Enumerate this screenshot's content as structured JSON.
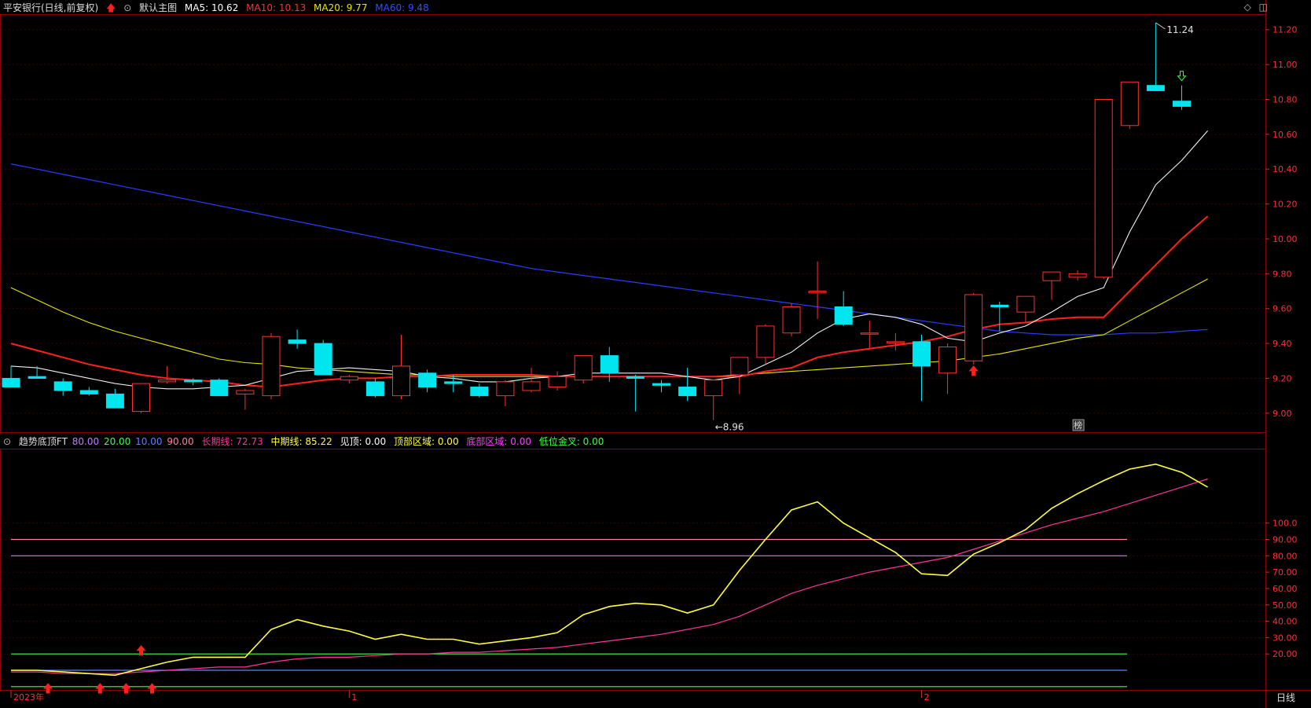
{
  "main": {
    "title": "平安银行(日线,前复权)",
    "template_label": "默认主图",
    "legend": [
      {
        "label": "MA5: 10.62",
        "color": "#ffffff"
      },
      {
        "label": "MA10: 10.13",
        "color": "#ff3030"
      },
      {
        "label": "MA20: 9.77",
        "color": "#e6e600"
      },
      {
        "label": "MA60: 9.48",
        "color": "#3050ff"
      }
    ],
    "y_ticks": [
      "11.20",
      "11.00",
      "10.80",
      "10.60",
      "10.40",
      "10.20",
      "10.00",
      "9.80",
      "9.60",
      "9.40",
      "9.20",
      "9.00"
    ],
    "high_label": "11.24",
    "low_label": "8.96",
    "tag_label": "榜"
  },
  "indicator": {
    "name": "趋势底顶FT",
    "legend": [
      {
        "label": "80.00",
        "color": "#c080ff"
      },
      {
        "label": "20.00",
        "color": "#40ff40"
      },
      {
        "label": "10.00",
        "color": "#6080ff"
      },
      {
        "label": "90.00",
        "color": "#ff80a0"
      },
      {
        "label": "长期线: 72.73",
        "color": "#ff3399"
      },
      {
        "label": "中期线: 85.22",
        "color": "#ffff40"
      },
      {
        "label": "见顶: 0.00",
        "color": "#ffffff"
      },
      {
        "label": "顶部区域: 0.00",
        "color": "#ffff40"
      },
      {
        "label": "底部区域: 0.00",
        "color": "#ff40ff"
      },
      {
        "label": "低位金叉: 0.00",
        "color": "#40ff40"
      }
    ],
    "y_ticks": [
      "100.0",
      "90.00",
      "80.00",
      "70.00",
      "60.00",
      "50.00",
      "40.00",
      "30.00",
      "20.00"
    ]
  },
  "x_labels": [
    "2023年",
    "1",
    "2"
  ],
  "period_label": "日线",
  "colors": {
    "up": "#ff3030",
    "down": "#00e5ee",
    "grid": "#3a0000",
    "axis": "#8b0000"
  },
  "chart_data": {
    "type": "candlestick",
    "candles": [
      {
        "o": 9.2,
        "h": 9.27,
        "l": 9.15,
        "c": 9.15
      },
      {
        "o": 9.21,
        "h": 9.27,
        "l": 9.2,
        "c": 9.2
      },
      {
        "o": 9.18,
        "h": 9.2,
        "l": 9.1,
        "c": 9.13
      },
      {
        "o": 9.13,
        "h": 9.15,
        "l": 9.1,
        "c": 9.11
      },
      {
        "o": 9.11,
        "h": 9.14,
        "l": 9.03,
        "c": 9.03
      },
      {
        "o": 9.01,
        "h": 9.17,
        "l": 9.0,
        "c": 9.17
      },
      {
        "o": 9.18,
        "h": 9.27,
        "l": 9.17,
        "c": 9.19
      },
      {
        "o": 9.19,
        "h": 9.2,
        "l": 9.16,
        "c": 9.18
      },
      {
        "o": 9.19,
        "h": 9.2,
        "l": 9.1,
        "c": 9.1
      },
      {
        "o": 9.11,
        "h": 9.14,
        "l": 9.02,
        "c": 9.13
      },
      {
        "o": 9.1,
        "h": 9.46,
        "l": 9.08,
        "c": 9.44
      },
      {
        "o": 9.42,
        "h": 9.48,
        "l": 9.37,
        "c": 9.4
      },
      {
        "o": 9.4,
        "h": 9.42,
        "l": 9.22,
        "c": 9.22
      },
      {
        "o": 9.19,
        "h": 9.22,
        "l": 9.17,
        "c": 9.21
      },
      {
        "o": 9.18,
        "h": 9.2,
        "l": 9.09,
        "c": 9.1
      },
      {
        "o": 9.1,
        "h": 9.45,
        "l": 9.08,
        "c": 9.27
      },
      {
        "o": 9.23,
        "h": 9.25,
        "l": 9.12,
        "c": 9.15
      },
      {
        "o": 9.18,
        "h": 9.22,
        "l": 9.12,
        "c": 9.17
      },
      {
        "o": 9.15,
        "h": 9.17,
        "l": 9.09,
        "c": 9.1
      },
      {
        "o": 9.1,
        "h": 9.19,
        "l": 9.04,
        "c": 9.18
      },
      {
        "o": 9.13,
        "h": 9.26,
        "l": 9.12,
        "c": 9.18
      },
      {
        "o": 9.15,
        "h": 9.24,
        "l": 9.13,
        "c": 9.21
      },
      {
        "o": 9.19,
        "h": 9.33,
        "l": 9.17,
        "c": 9.33
      },
      {
        "o": 9.33,
        "h": 9.38,
        "l": 9.18,
        "c": 9.23
      },
      {
        "o": 9.21,
        "h": 9.22,
        "l": 9.01,
        "c": 9.2
      },
      {
        "o": 9.17,
        "h": 9.19,
        "l": 9.12,
        "c": 9.16
      },
      {
        "o": 9.15,
        "h": 9.26,
        "l": 9.07,
        "c": 9.1
      },
      {
        "o": 9.1,
        "h": 9.18,
        "l": 8.96,
        "c": 9.19
      },
      {
        "o": 9.22,
        "h": 9.32,
        "l": 9.11,
        "c": 9.32
      },
      {
        "o": 9.32,
        "h": 9.51,
        "l": 9.28,
        "c": 9.5
      },
      {
        "o": 9.46,
        "h": 9.63,
        "l": 9.44,
        "c": 9.61
      },
      {
        "o": 9.69,
        "h": 9.87,
        "l": 9.54,
        "c": 9.7
      },
      {
        "o": 9.61,
        "h": 9.7,
        "l": 9.5,
        "c": 9.51
      },
      {
        "o": 9.46,
        "h": 9.53,
        "l": 9.37,
        "c": 9.46
      },
      {
        "o": 9.41,
        "h": 9.46,
        "l": 9.36,
        "c": 9.41
      },
      {
        "o": 9.41,
        "h": 9.45,
        "l": 9.07,
        "c": 9.27
      },
      {
        "o": 9.23,
        "h": 9.4,
        "l": 9.11,
        "c": 9.38
      },
      {
        "o": 9.3,
        "h": 9.69,
        "l": 9.28,
        "c": 9.68
      },
      {
        "o": 9.62,
        "h": 9.64,
        "l": 9.47,
        "c": 9.61
      },
      {
        "o": 9.58,
        "h": 9.67,
        "l": 9.52,
        "c": 9.67
      },
      {
        "o": 9.76,
        "h": 9.81,
        "l": 9.65,
        "c": 9.81
      },
      {
        "o": 9.78,
        "h": 9.82,
        "l": 9.76,
        "c": 9.8
      },
      {
        "o": 9.78,
        "h": 10.8,
        "l": 9.77,
        "c": 10.8
      },
      {
        "o": 10.65,
        "h": 10.9,
        "l": 10.63,
        "c": 10.9
      },
      {
        "o": 10.88,
        "h": 11.24,
        "l": 10.85,
        "c": 10.85
      },
      {
        "o": 10.79,
        "h": 10.88,
        "l": 10.74,
        "c": 10.76
      }
    ],
    "ma5": [
      9.27,
      9.26,
      9.23,
      9.2,
      9.17,
      9.15,
      9.14,
      9.14,
      9.15,
      9.16,
      9.2,
      9.24,
      9.25,
      9.26,
      9.25,
      9.24,
      9.21,
      9.2,
      9.18,
      9.18,
      9.2,
      9.21,
      9.23,
      9.23,
      9.23,
      9.23,
      9.21,
      9.19,
      9.21,
      9.28,
      9.35,
      9.46,
      9.54,
      9.57,
      9.55,
      9.51,
      9.43,
      9.41,
      9.46,
      9.5,
      9.58,
      9.67,
      9.72,
      10.04,
      10.31,
      10.45,
      10.62
    ],
    "ma10": [
      9.4,
      9.36,
      9.32,
      9.28,
      9.25,
      9.22,
      9.2,
      9.19,
      9.18,
      9.16,
      9.15,
      9.17,
      9.19,
      9.2,
      9.2,
      9.21,
      9.21,
      9.22,
      9.22,
      9.22,
      9.22,
      9.21,
      9.21,
      9.21,
      9.21,
      9.21,
      9.21,
      9.21,
      9.21,
      9.24,
      9.26,
      9.32,
      9.35,
      9.37,
      9.39,
      9.41,
      9.44,
      9.48,
      9.51,
      9.52,
      9.54,
      9.55,
      9.55,
      9.7,
      9.85,
      10.0,
      10.13
    ],
    "ma20": [
      9.72,
      9.65,
      9.58,
      9.52,
      9.47,
      9.43,
      9.39,
      9.35,
      9.31,
      9.29,
      9.28,
      9.26,
      9.25,
      9.24,
      9.23,
      9.22,
      9.22,
      9.21,
      9.21,
      9.21,
      9.21,
      9.21,
      9.21,
      9.21,
      9.21,
      9.21,
      9.21,
      9.21,
      9.22,
      9.23,
      9.24,
      9.25,
      9.26,
      9.27,
      9.28,
      9.29,
      9.3,
      9.32,
      9.34,
      9.37,
      9.4,
      9.43,
      9.45,
      9.53,
      9.61,
      9.69,
      9.77
    ],
    "ma60": [
      10.43,
      10.4,
      10.37,
      10.34,
      10.31,
      10.28,
      10.25,
      10.22,
      10.19,
      10.16,
      10.13,
      10.1,
      10.07,
      10.04,
      10.01,
      9.98,
      9.95,
      9.92,
      9.89,
      9.86,
      9.83,
      9.81,
      9.79,
      9.77,
      9.75,
      9.73,
      9.71,
      9.69,
      9.67,
      9.65,
      9.63,
      9.61,
      9.59,
      9.57,
      9.55,
      9.53,
      9.51,
      9.49,
      9.47,
      9.46,
      9.45,
      9.45,
      9.45,
      9.46,
      9.46,
      9.47,
      9.48
    ],
    "ind_mid": [
      10,
      10,
      9,
      8,
      7,
      11,
      15,
      18,
      18,
      18,
      35,
      41,
      37,
      34,
      29,
      32,
      29,
      29,
      26,
      28,
      30,
      33,
      44,
      49,
      51,
      50,
      45,
      50,
      71,
      90,
      108,
      113,
      100,
      91,
      82,
      69,
      68,
      81,
      88,
      96,
      109,
      118,
      126,
      133,
      136,
      131,
      122
    ],
    "ind_long": [
      9,
      9,
      8,
      8,
      8,
      9,
      10,
      11,
      12,
      12,
      15,
      17,
      18,
      18,
      19,
      20,
      20,
      21,
      21,
      22,
      23,
      24,
      26,
      28,
      30,
      32,
      35,
      38,
      43,
      50,
      57,
      62,
      66,
      70,
      73,
      76,
      79,
      84,
      89,
      94,
      99,
      103,
      107,
      112,
      117,
      122,
      127
    ],
    "lines": {
      "l80": 80,
      "l20": 20,
      "l10": 10,
      "l90": 90,
      "l0": 0
    },
    "ylim_main": [
      8.9,
      11.28
    ],
    "ylim_ind": [
      -2,
      145
    ]
  }
}
